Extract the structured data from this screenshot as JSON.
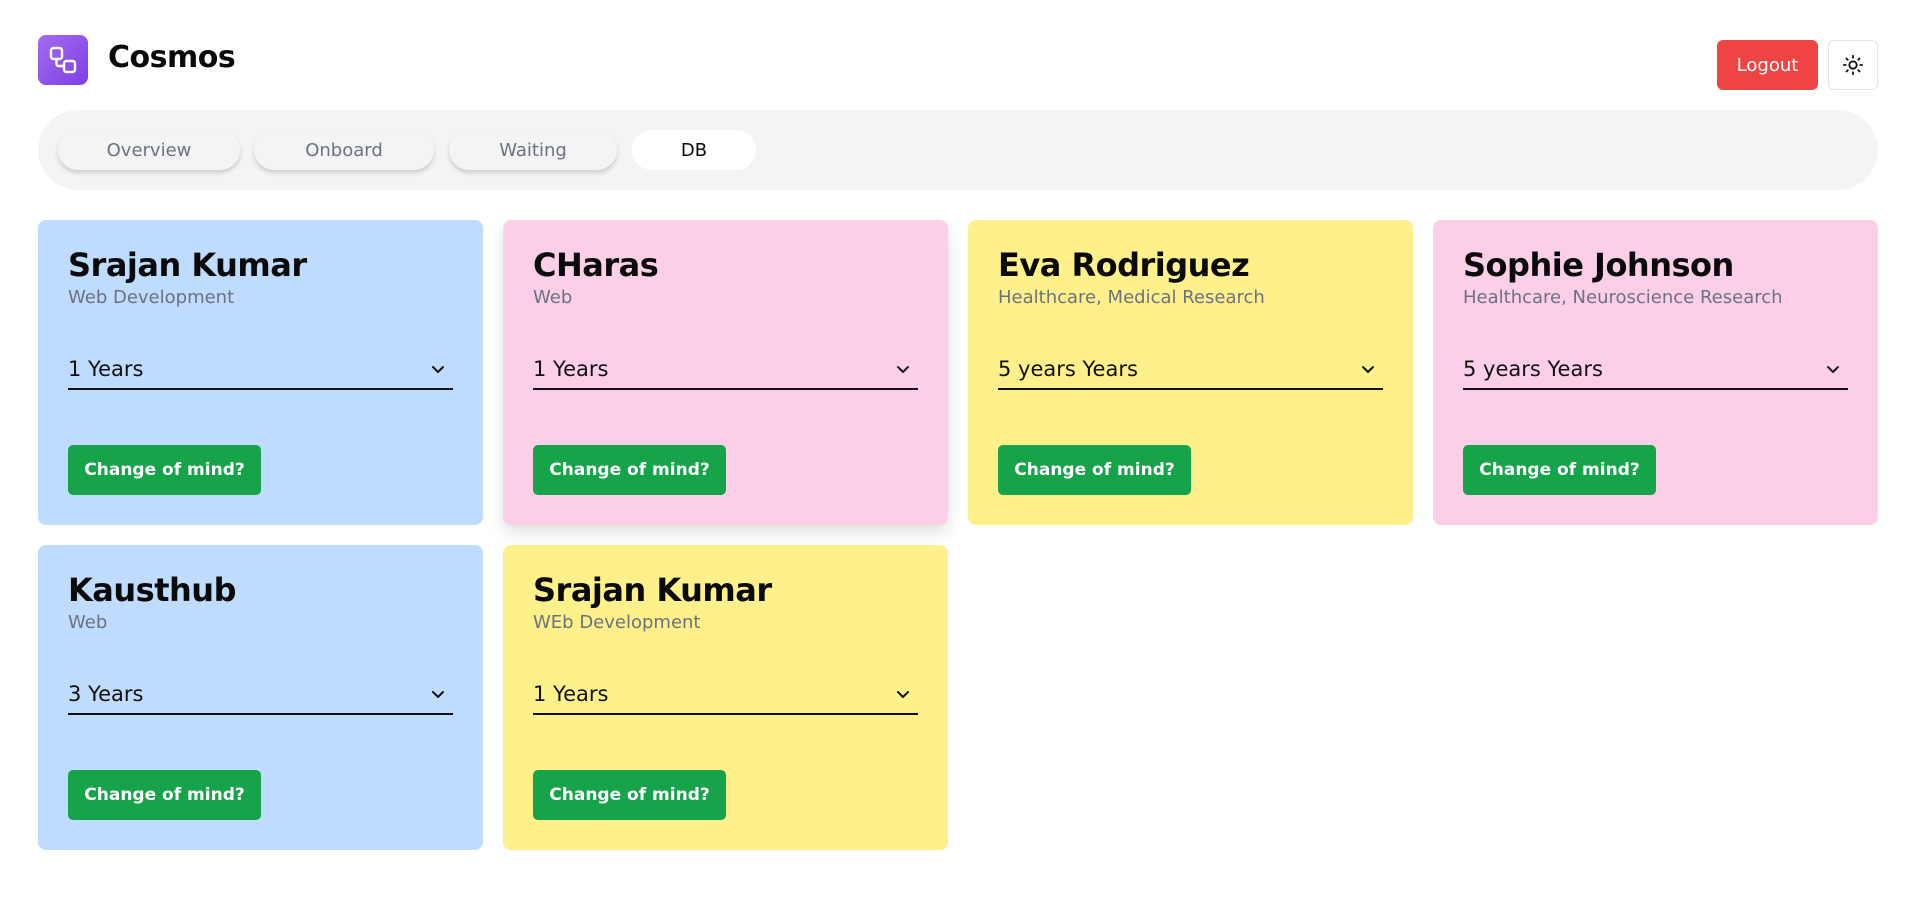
{
  "header": {
    "brand": "Cosmos",
    "logout_label": "Logout",
    "logo_icon": "app-logo-icon",
    "theme_icon": "sun-icon"
  },
  "tabs": [
    {
      "label": "Overview",
      "active": false
    },
    {
      "label": "Onboard",
      "active": false
    },
    {
      "label": "Waiting",
      "active": false
    },
    {
      "label": "DB",
      "active": true
    }
  ],
  "cards": [
    {
      "name": "Srajan Kumar",
      "field": "Web Development",
      "experience": "1 Years",
      "action": "Change of mind?",
      "color": "#bfdbfe"
    },
    {
      "name": "CHaras",
      "field": "Web",
      "experience": "1 Years",
      "action": "Change of mind?",
      "color": "#fbcfe8"
    },
    {
      "name": "Eva Rodriguez",
      "field": "Healthcare, Medical Research",
      "experience": "5 years Years",
      "action": "Change of mind?",
      "color": "#fef08a"
    },
    {
      "name": "Sophie Johnson",
      "field": "Healthcare, Neuroscience Research",
      "experience": "5 years Years",
      "action": "Change of mind?",
      "color": "#fbcfe8"
    },
    {
      "name": "Kausthub",
      "field": "Web",
      "experience": "3 Years",
      "action": "Change of mind?",
      "color": "#bfdbfe"
    },
    {
      "name": "Srajan Kumar",
      "field": "WEb Development",
      "experience": "1 Years",
      "action": "Change of mind?",
      "color": "#fef08a"
    }
  ],
  "colors": {
    "logout": "#ef4444",
    "action": "#16a34a",
    "logo": "#8b5cf6"
  }
}
